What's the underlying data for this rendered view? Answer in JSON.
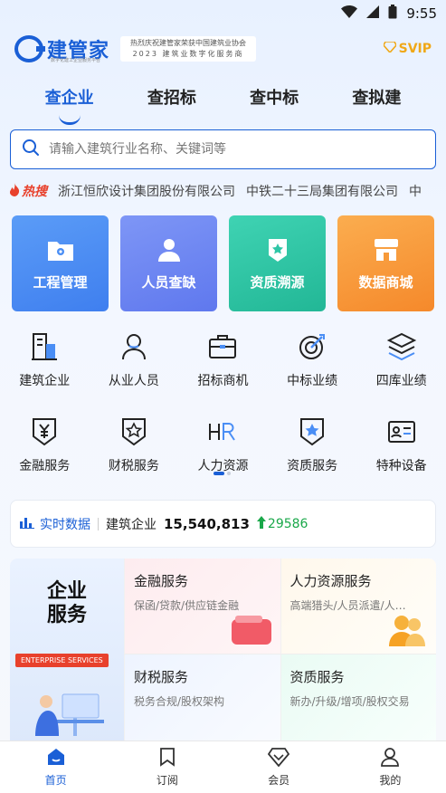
{
  "status": {
    "time": "9:55"
  },
  "header": {
    "app_name": "建管家",
    "logo_sub": "数字化建工企业服务平台",
    "ad_line1": "热烈庆祝建管家荣获中国建筑业协会",
    "ad_line2": "2023 建筑业数字化服务商",
    "vip_label": "SVIP"
  },
  "tabs": [
    {
      "label": "查企业"
    },
    {
      "label": "查招标"
    },
    {
      "label": "查中标"
    },
    {
      "label": "查拟建"
    }
  ],
  "search": {
    "placeholder": "请输入建筑行业名称、关键词等"
  },
  "hot": {
    "label": "热搜",
    "items": [
      "浙江恒欣设计集团股份有限公司",
      "中铁二十三局集团有限公司",
      "中"
    ]
  },
  "big_cards": [
    {
      "label": "工程管理",
      "color": "#4a8ef5"
    },
    {
      "label": "人员查缺",
      "color": "#6d87f3"
    },
    {
      "label": "资质溯源",
      "color": "#2fc6a6"
    },
    {
      "label": "数据商城",
      "color": "#f79a3a"
    }
  ],
  "grid": [
    {
      "label": "建筑企业",
      "icon": "building-icon"
    },
    {
      "label": "从业人员",
      "icon": "person-icon"
    },
    {
      "label": "招标商机",
      "icon": "briefcase-icon"
    },
    {
      "label": "中标业绩",
      "icon": "target-icon"
    },
    {
      "label": "四库业绩",
      "icon": "layers-icon"
    },
    {
      "label": "金融服务",
      "icon": "yen-shield-icon"
    },
    {
      "label": "财税服务",
      "icon": "tax-shield-icon"
    },
    {
      "label": "人力资源",
      "icon": "hr-icon"
    },
    {
      "label": "资质服务",
      "icon": "star-shield-icon"
    },
    {
      "label": "特种设备",
      "icon": "id-card-icon"
    }
  ],
  "realtime": {
    "label": "实时数据",
    "category": "建筑企业",
    "count": "15,540,813",
    "increase": "29586"
  },
  "services": {
    "title_line1": "企业",
    "title_line2": "服务",
    "tag": "ENTERPRISE SERVICES",
    "items": [
      {
        "title": "金融服务",
        "desc": "保函/贷款/供应链金融"
      },
      {
        "title": "人力资源服务",
        "desc": "高端猎头/人员派遣/人…"
      },
      {
        "title": "财税服务",
        "desc": "税务合规/股权架构"
      },
      {
        "title": "资质服务",
        "desc": "新办/升级/增项/股权交易"
      }
    ]
  },
  "nav": [
    {
      "label": "首页"
    },
    {
      "label": "订阅"
    },
    {
      "label": "会员"
    },
    {
      "label": "我的"
    }
  ]
}
